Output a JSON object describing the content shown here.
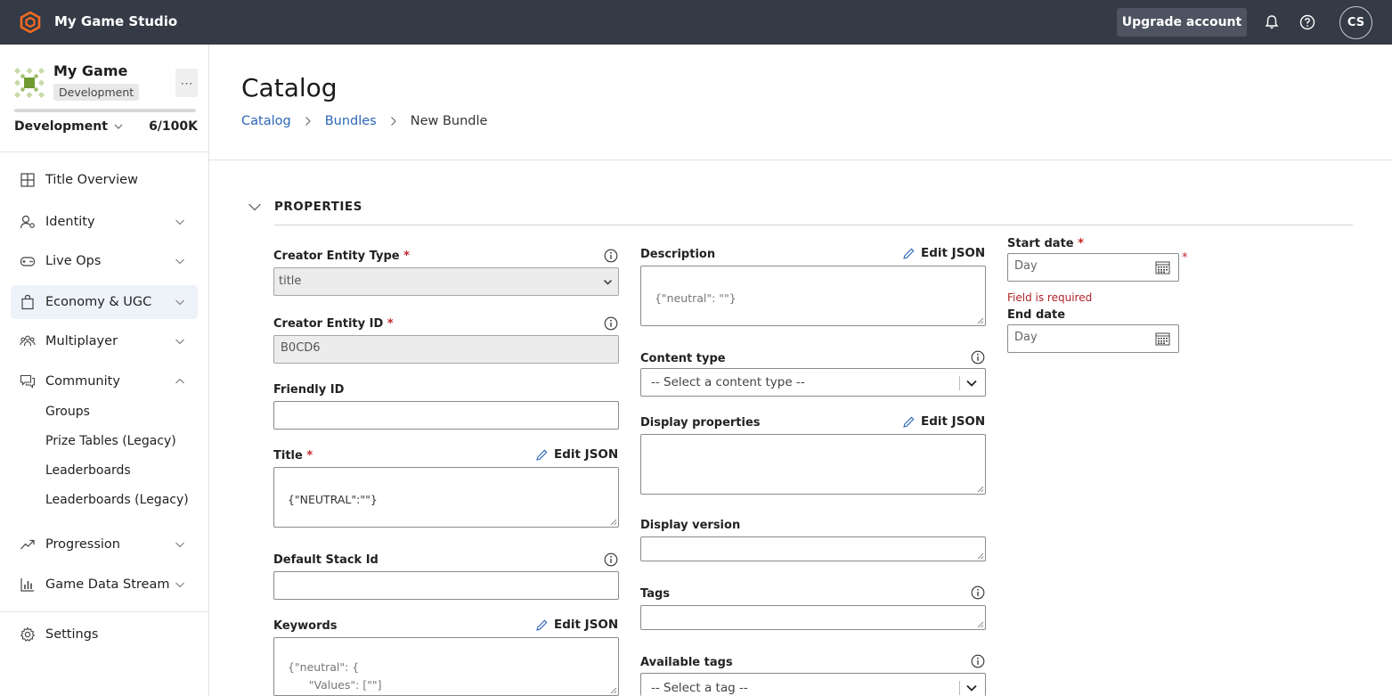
{
  "header": {
    "studio_name": "My Game Studio",
    "upgrade_label": "Upgrade account",
    "avatar_initials": "CS"
  },
  "sidebar": {
    "game_name": "My Game",
    "environment_badge": "Development",
    "environment_selected": "Development",
    "usage": "6/100K",
    "nav": [
      {
        "label": "Title Overview"
      },
      {
        "label": "Identity"
      },
      {
        "label": "Live Ops"
      },
      {
        "label": "Economy & UGC"
      },
      {
        "label": "Multiplayer"
      },
      {
        "label": "Community"
      },
      {
        "label": "Progression"
      },
      {
        "label": "Game Data Stream"
      },
      {
        "label": "Settings"
      }
    ],
    "community_sub": [
      {
        "label": "Groups"
      },
      {
        "label": "Prize Tables (Legacy)"
      },
      {
        "label": "Leaderboards"
      },
      {
        "label": "Leaderboards (Legacy)"
      }
    ]
  },
  "page": {
    "title": "Catalog",
    "breadcrumb": [
      "Catalog",
      "Bundles",
      "New Bundle"
    ],
    "section_title": "PROPERTIES"
  },
  "form": {
    "edit_json_label": "Edit JSON",
    "required_mark": "*",
    "creator_entity_type": {
      "label": "Creator Entity Type",
      "value": "title"
    },
    "creator_entity_id": {
      "label": "Creator Entity ID",
      "value": "B0CD6"
    },
    "friendly_id": {
      "label": "Friendly ID",
      "value": ""
    },
    "title": {
      "label": "Title",
      "value": "{\"NEUTRAL\":\"\"}"
    },
    "default_stack_id": {
      "label": "Default Stack Id",
      "value": ""
    },
    "keywords": {
      "label": "Keywords",
      "value": "{\"neutral\": {\n        \"Values\": [\"\"]\n}}"
    },
    "description": {
      "label": "Description",
      "value": "{\"neutral\": \"\"}"
    },
    "content_type": {
      "label": "Content type",
      "value": "-- Select a content type --"
    },
    "display_properties": {
      "label": "Display properties",
      "value": ""
    },
    "display_version": {
      "label": "Display version",
      "value": ""
    },
    "tags": {
      "label": "Tags",
      "value": ""
    },
    "available_tags": {
      "label": "Available tags",
      "value": "-- Select a tag --"
    },
    "start_date": {
      "label": "Start date",
      "placeholder": "Day",
      "error": "Field is required"
    },
    "end_date": {
      "label": "End date",
      "placeholder": "Day"
    }
  },
  "colors": {
    "topbar": "#343a46",
    "accent_orange": "#f26b21",
    "link_blue": "#2c66b8",
    "required_red": "#c2272d",
    "active_nav_bg": "#eef3fa"
  }
}
